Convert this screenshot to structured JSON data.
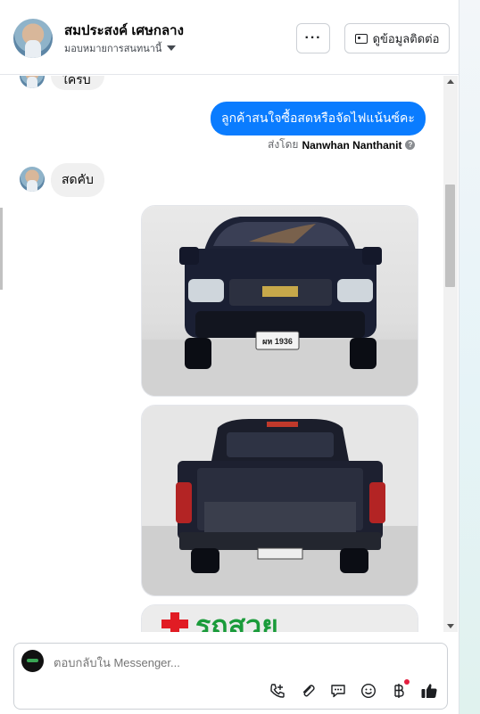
{
  "header": {
    "contact_name": "สมประสงค์ เศษกลาง",
    "assign_label": "มอบหมายการสนทนานี้",
    "more_label": "···",
    "contact_button_label": "ดูข้อมูลติดต่อ"
  },
  "messages": {
    "partial_incoming": "ใครบ",
    "outgoing": "ลูกค้าสนใจซื้อสดหรือจัดไฟแน้นซ์คะ",
    "sent_by_prefix": "ส่งโดย",
    "sent_by_name": "Nanwhan Nanthanit",
    "incoming": "สดคับ",
    "photo3_text": "รถสวย",
    "plate_text": "ผห 1936"
  },
  "composer": {
    "placeholder": "ตอบกลับใน Messenger..."
  },
  "icons": {
    "call": "phone-add-icon",
    "attach": "paperclip-icon",
    "reply": "chat-bubble-icon",
    "emoji": "smiley-icon",
    "payment": "baht-icon",
    "like": "thumbs-up-icon"
  },
  "colors": {
    "accent": "#0a7cff",
    "bubble_incoming": "#f0f0f0",
    "notification_dot": "#e41e3f"
  }
}
